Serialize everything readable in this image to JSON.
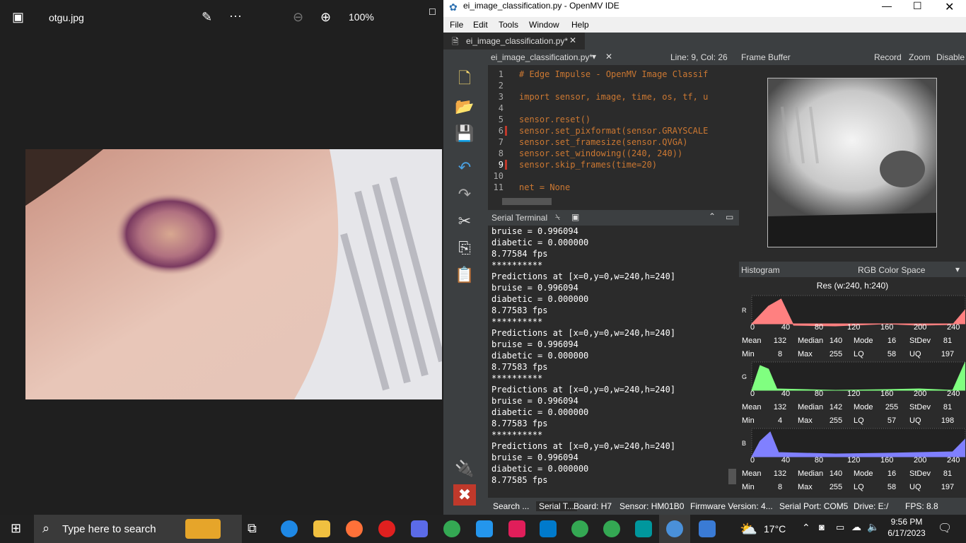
{
  "photos": {
    "filename": "otgu.jpg",
    "zoom": "100%"
  },
  "ide": {
    "title": "ei_image_classification.py - OpenMV IDE",
    "menu": [
      "File",
      "Edit",
      "Tools",
      "Window",
      "Help"
    ],
    "tab": "ei_image_classification.py*",
    "editor_file": "ei_image_classification.py*",
    "cursor": "Line: 9, Col: 26",
    "code_lines": [
      {
        "n": "1",
        "t": "# Edge Impulse - OpenMV Image Classif"
      },
      {
        "n": "2",
        "t": ""
      },
      {
        "n": "3",
        "t": "import sensor, image, time, os, tf, u"
      },
      {
        "n": "4",
        "t": ""
      },
      {
        "n": "5",
        "t": "sensor.reset()"
      },
      {
        "n": "6",
        "t": "sensor.set_pixformat(sensor.GRAYSCALE"
      },
      {
        "n": "7",
        "t": "sensor.set_framesize(sensor.QVGA)"
      },
      {
        "n": "8",
        "t": "sensor.set_windowing((240, 240))"
      },
      {
        "n": "9",
        "t": "sensor.skip_frames(time=20)"
      },
      {
        "n": "10",
        "t": ""
      },
      {
        "n": "11",
        "t": "net = None"
      }
    ],
    "serial_title": "Serial Terminal",
    "serial_lines": [
      "bruise = 0.996094",
      "diabetic = 0.000000",
      "8.77584 fps",
      "**********",
      "Predictions at [x=0,y=0,w=240,h=240]",
      "bruise = 0.996094",
      "diabetic = 0.000000",
      "8.77583 fps",
      "**********",
      "Predictions at [x=0,y=0,w=240,h=240]",
      "bruise = 0.996094",
      "diabetic = 0.000000",
      "8.77583 fps",
      "**********",
      "Predictions at [x=0,y=0,w=240,h=240]",
      "bruise = 0.996094",
      "diabetic = 0.000000",
      "8.77583 fps",
      "**********",
      "Predictions at [x=0,y=0,w=240,h=240]",
      "bruise = 0.996094",
      "diabetic = 0.000000",
      "8.77585 fps"
    ],
    "frame_buffer": {
      "title": "Frame Buffer",
      "record": "Record",
      "zoom": "Zoom",
      "disable": "Disable"
    },
    "histogram": {
      "title": "Histogram",
      "color_space": "RGB Color Space",
      "res": "Res (w:240, h:240)",
      "axis_ticks": [
        "0",
        "40",
        "80",
        "120",
        "160",
        "200",
        "240"
      ],
      "channels": [
        {
          "label": "R",
          "color": "#ff8080",
          "mean": "132",
          "median": "140",
          "mode": "16",
          "stdev": "81",
          "min": "8",
          "max": "255",
          "lq": "58",
          "uq": "197"
        },
        {
          "label": "G",
          "color": "#80ff80",
          "mean": "132",
          "median": "142",
          "mode": "255",
          "stdev": "81",
          "min": "4",
          "max": "255",
          "lq": "57",
          "uq": "198"
        },
        {
          "label": "B",
          "color": "#8080ff",
          "mean": "132",
          "median": "140",
          "mode": "16",
          "stdev": "81",
          "min": "8",
          "max": "255",
          "lq": "58",
          "uq": "197"
        }
      ]
    },
    "status": {
      "search": "Search ...",
      "serial": "Serial T...",
      "board": "Board: H7",
      "sensor": "Sensor: HM01B0",
      "firmware": "Firmware Version: 4...",
      "port": "Serial Port: COM5",
      "drive": "Drive: E:/",
      "fps": "FPS:  8.8"
    }
  },
  "taskbar": {
    "search_placeholder": "Type here to search",
    "weather": "17°C",
    "time": "9:56 PM",
    "date": "6/17/2023"
  }
}
